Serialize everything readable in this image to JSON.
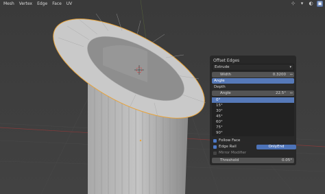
{
  "menu": [
    "Mesh",
    "Vertex",
    "Edge",
    "Face",
    "UV"
  ],
  "header_icons": [
    "gizmo-icon",
    "dropdown-icon",
    "overlay-icon",
    "shading-icon"
  ],
  "panel": {
    "title": "Offset Edges",
    "mode": "Extrude",
    "width_label": "Width",
    "width_value": "0.3200",
    "angle_label_1": "Angle",
    "depth_label": "Depth",
    "angle_label_2": "Angle",
    "angle_value": "22.5°",
    "angle_options": [
      "0°",
      "15°",
      "30°",
      "45°",
      "60°",
      "75°",
      "90°"
    ],
    "follow_face": "Follow Face",
    "edge_rail": "Edge Rail",
    "edge_rail_option": "OnlyEnd",
    "mirror_modifier": "Mirror Modifier",
    "threshold_label": "Threshold",
    "threshold_value": "0.05°"
  },
  "colors": {
    "background": "#3d3d3d",
    "selection": "#5679b8",
    "edge_highlight": "#e8a33a"
  }
}
